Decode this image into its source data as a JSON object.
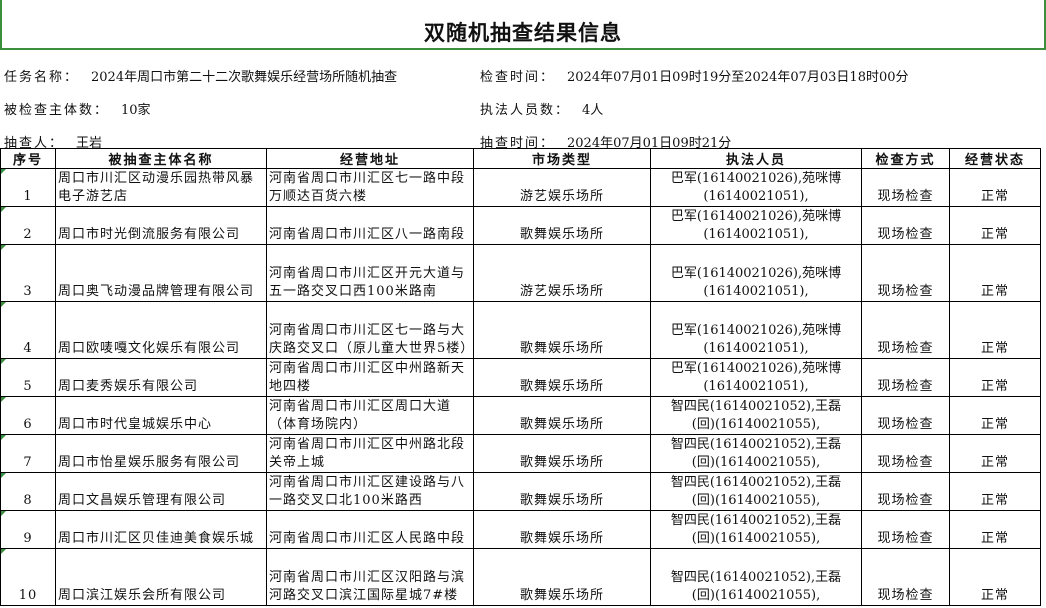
{
  "title": "双随机抽查结果信息",
  "info": {
    "task_label": "任务名称：",
    "task_value": "2024年周口市第二十二次歌舞娱乐经营场所随机抽查",
    "time_label": "检查时间：",
    "time_value": "2024年07月01日09时19分至2024年07月03日18时00分",
    "count_label": "被检查主体数：",
    "count_value": "10家",
    "officers_label": "执法人员数：",
    "officers_value": "4人",
    "sampler_label": "抽查人：",
    "sampler_value": "王岩",
    "sample_time_label": "抽查时间：",
    "sample_time_value": "2024年07月01日09时21分"
  },
  "table": {
    "headers": [
      "序号",
      "被抽查主体名称",
      "经营地址",
      "市场类型",
      "执法人员",
      "检查方式",
      "经营状态"
    ],
    "rows": [
      {
        "no": "1",
        "name": "周口市川汇区动漫乐园热带风暴电子游艺店",
        "addr": "河南省周口市川汇区七一路中段万顺达百货六楼",
        "type": "游艺娱乐场所",
        "law1": "巴军(16140021026),苑咪博",
        "law2": "(16140021051),",
        "method": "现场检查",
        "status": "正常"
      },
      {
        "no": "2",
        "name": "周口市时光倒流服务有限公司",
        "addr": "河南省周口市川汇区八一路南段",
        "type": "歌舞娱乐场所",
        "law1": "巴军(16140021026),苑咪博",
        "law2": "(16140021051),",
        "method": "现场检查",
        "status": "正常"
      },
      {
        "no": "3",
        "name": "周口奥飞动漫品牌管理有限公司",
        "addr": "河南省周口市川汇区开元大道与五一路交叉口西100米路南",
        "type": "游艺娱乐场所",
        "law1": "巴军(16140021026),苑咪博",
        "law2": "(16140021051),",
        "method": "现场检查",
        "status": "正常"
      },
      {
        "no": "4",
        "name": "周口欧唛嘎文化娱乐有限公司",
        "addr": "河南省周口市川汇区七一路与大庆路交叉口（原儿童大世界5楼）",
        "type": "歌舞娱乐场所",
        "law1": "巴军(16140021026),苑咪博",
        "law2": "(16140021051),",
        "method": "现场检查",
        "status": "正常"
      },
      {
        "no": "5",
        "name": "周口麦秀娱乐有限公司",
        "addr": "河南省周口市川汇区中州路新天地四楼",
        "type": "歌舞娱乐场所",
        "law1": "巴军(16140021026),苑咪博",
        "law2": "(16140021051),",
        "method": "现场检查",
        "status": "正常"
      },
      {
        "no": "6",
        "name": "周口市时代皇城娱乐中心",
        "addr": "河南省周口市川汇区周口大道（体育场院内）",
        "type": "歌舞娱乐场所",
        "law1": "智四民(16140021052),王磊",
        "law2": "(回)(16140021055),",
        "method": "现场检查",
        "status": "正常"
      },
      {
        "no": "7",
        "name": "周口市怡星娱乐服务有限公司",
        "addr": "河南省周口市川汇区中州路北段关帝上城",
        "type": "歌舞娱乐场所",
        "law1": "智四民(16140021052),王磊",
        "law2": "(回)(16140021055),",
        "method": "现场检查",
        "status": "正常"
      },
      {
        "no": "8",
        "name": "周口文昌娱乐管理有限公司",
        "addr": "河南省周口市川汇区建设路与八一路交叉口北100米路西",
        "type": "歌舞娱乐场所",
        "law1": "智四民(16140021052),王磊",
        "law2": "(回)(16140021055),",
        "method": "现场检查",
        "status": "正常"
      },
      {
        "no": "9",
        "name": "周口市川汇区贝佳迪美食娱乐城",
        "addr": "河南省周口市川汇区人民路中段",
        "type": "歌舞娱乐场所",
        "law1": "智四民(16140021052),王磊",
        "law2": "(回)(16140021055),",
        "method": "现场检查",
        "status": "正常"
      },
      {
        "no": "10",
        "name": "周口滨江娱乐会所有限公司",
        "addr": "河南省周口市川汇区汉阳路与滨河路交叉口滨江国际星城7#楼",
        "type": "歌舞娱乐场所",
        "law1": "智四民(16140021052),王磊",
        "law2": "(回)(16140021055),",
        "method": "现场检查",
        "status": "正常"
      }
    ]
  }
}
